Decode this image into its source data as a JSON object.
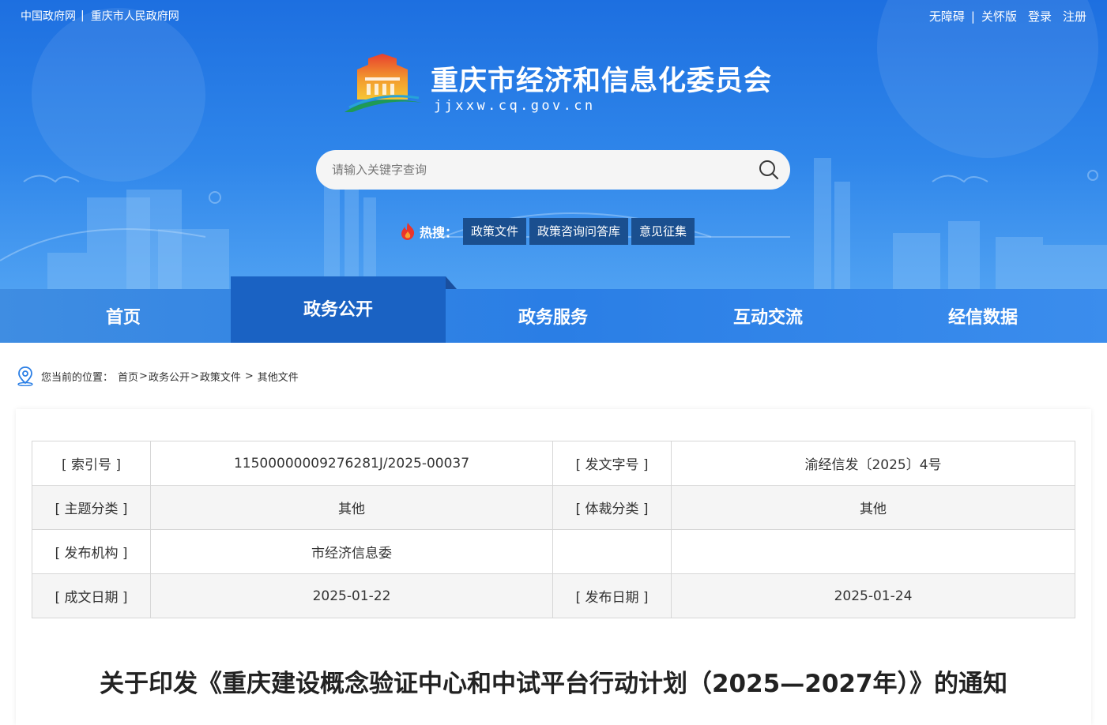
{
  "topbar": {
    "left_links": [
      "中国政府网",
      "重庆市人民政府网"
    ],
    "separator": "|",
    "right_links": [
      "无障碍",
      "关怀版",
      "登录",
      "注册"
    ]
  },
  "site": {
    "title": "重庆市经济和信息化委员会",
    "domain": "jjxxw.cq.gov.cn",
    "logo_icon": "gov-building-logo"
  },
  "search": {
    "placeholder": "请输入关键字查询",
    "value": "",
    "icon": "search-icon"
  },
  "hot_search": {
    "label": "热搜：",
    "icon": "fire-icon",
    "tags": [
      "政策文件",
      "政策咨询问答库",
      "意见征集"
    ]
  },
  "nav": {
    "items": [
      "首页",
      "政务公开",
      "政务服务",
      "互动交流",
      "经信数据"
    ],
    "active": "政务公开"
  },
  "breadcrumb": {
    "label": "您当前的位置：",
    "items": [
      "首页",
      "政务公开",
      "政策文件",
      "其他文件"
    ],
    "icon": "location-pin-icon"
  },
  "meta": {
    "index_label": "[ 索引号 ]",
    "index_value": "11500000009276281J/2025-00037",
    "docno_label": "[ 发文字号 ]",
    "docno_value": "渝经信发〔2025〕4号",
    "topic_label": "[ 主题分类 ]",
    "topic_value": "其他",
    "genre_label": "[ 体裁分类 ]",
    "genre_value": "其他",
    "issuer_label": "[ 发布机构 ]",
    "issuer_value": "市经济信息委",
    "created_label": "[ 成文日期 ]",
    "created_value": "2025-01-22",
    "published_label": "[ 发布日期 ]",
    "published_value": "2025-01-24"
  },
  "document": {
    "title": "关于印发《重庆建设概念验证中心和中试平台行动计划（2025—2027年）》的通知"
  },
  "colors": {
    "header_blue": "#2f86ea",
    "nav_active": "#1a62c3",
    "hot_tag_bg": "#1a4f8f",
    "table_border": "#d6d6d6",
    "table_alt_bg": "#f5f5f5"
  }
}
